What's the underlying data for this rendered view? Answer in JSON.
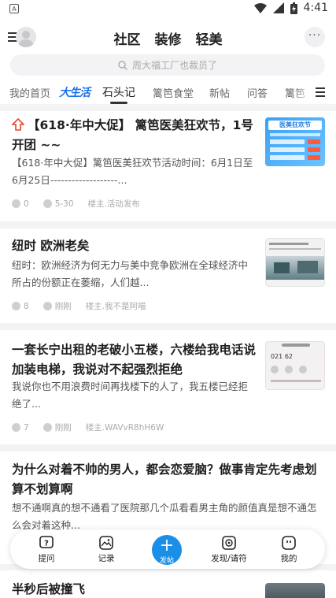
{
  "status_bar": {
    "time": "4:41"
  },
  "header": {
    "tabs": [
      "社区",
      "装修",
      "轻美"
    ],
    "more_label": "···"
  },
  "search": {
    "placeholder": "周大福工厂也裁员了"
  },
  "categories": {
    "items": [
      "我的首页",
      "大生活",
      "石头记",
      "篱笆食堂",
      "新帖",
      "问答",
      "篱笆"
    ],
    "active": "石头记"
  },
  "posts": [
    {
      "title": "【618·年中大促】 篱笆医美狂欢节，1号开团 ~~",
      "excerpt": "【618·年中大促】篱笆医美狂欢节活动时间：6月1日至6月25日-------------------...",
      "comments": "0",
      "time": "5-30",
      "author": "楼主.活动发布",
      "thumb_text": "医美狂欢节"
    },
    {
      "title": "纽时 欧洲老矣",
      "excerpt": "纽时：欧洲经济为何无力与美中竞争欧洲在全球经济中所占的份额正在萎缩，人们越...",
      "comments": "8",
      "time": "刚刚",
      "author": "楼主.我不是阿喵"
    },
    {
      "title": "一套长宁出租的老破小五楼，六楼给我电话说加装电梯，我说对不起强烈拒绝",
      "excerpt": "我说你也不用浪费时间再找楼下的人了，我五楼已经拒绝了...",
      "comments": "7",
      "time": "刚刚",
      "author": "楼主.WAVvR8hH6W",
      "thumb_text": "021 62"
    },
    {
      "title": "为什么对着不帅的男人，都会恋爱脑？做事肯定先考虑划算不划算啊",
      "excerpt": "想不通啊真的想不通看了医院那几个瓜看看男主角的颜值真是想不通怎么会对着这种..."
    },
    {
      "title": "半秒后被撞飞"
    }
  ],
  "bottom_nav": {
    "items": [
      "提问",
      "记录",
      "发帖",
      "发现/请符",
      "我的"
    ]
  },
  "colors": {
    "accent": "#1a8fe8",
    "hot_icon": "#e8442e",
    "logo": "#1a73e8"
  }
}
